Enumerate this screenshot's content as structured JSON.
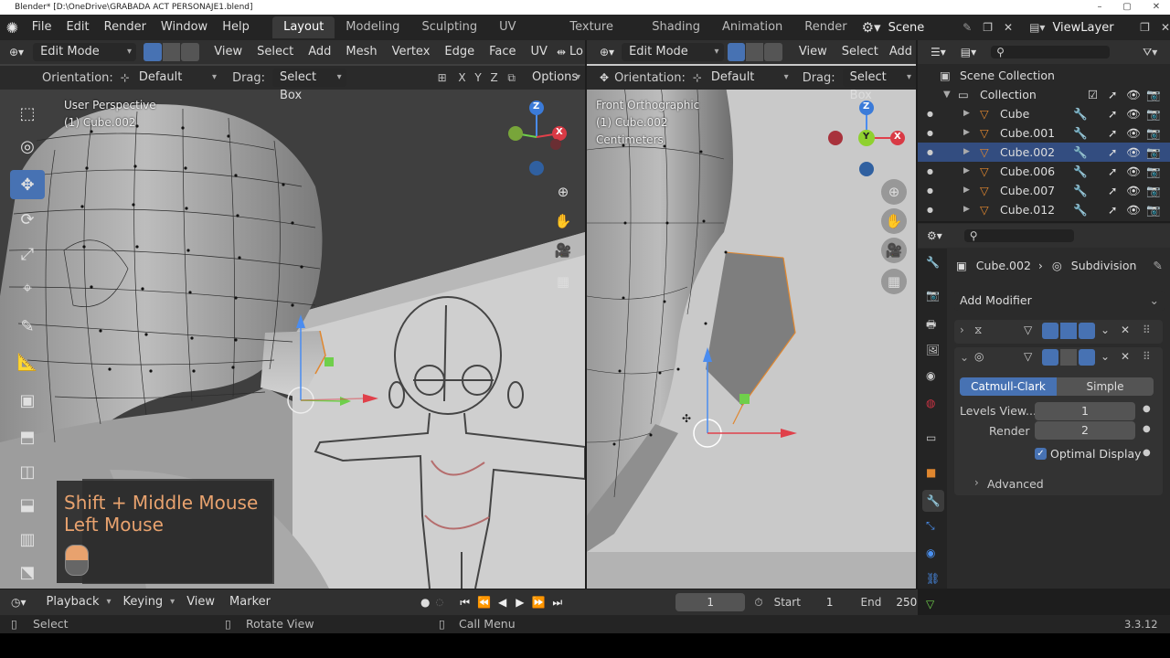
{
  "window": {
    "title": "Blender* [D:\\OneDrive\\GRABADA ACT PERSONAJE1.blend]",
    "minimize": "–",
    "maximize": "▢",
    "close": "✕"
  },
  "menubar": {
    "items": [
      "File",
      "Edit",
      "Render",
      "Window",
      "Help"
    ],
    "workspaces": [
      "Layout",
      "Modeling",
      "Sculpting",
      "UV Editing",
      "Texture Paint",
      "Shading",
      "Animation",
      "Render"
    ],
    "active_workspace": "Layout",
    "scene": "Scene",
    "view_layer": "ViewLayer"
  },
  "left_viewport": {
    "mode": "Edit Mode",
    "menus": [
      "View",
      "Select",
      "Add",
      "Mesh",
      "Vertex",
      "Edge",
      "Face",
      "UV",
      "Lo"
    ],
    "orientation_label": "Orientation:",
    "orientation_value": "Default",
    "drag_label": "Drag:",
    "drag_value": "Select Box",
    "axes": [
      "X",
      "Y",
      "Z"
    ],
    "options": "Options",
    "view_name": "User Perspective",
    "object_name": "(1) Cube.002",
    "keys_line1": "Shift + Middle Mouse",
    "keys_line2": "Left Mouse"
  },
  "right_viewport": {
    "mode": "Edit Mode",
    "menus": [
      "View",
      "Select",
      "Add"
    ],
    "orientation_label": "Orientation:",
    "orientation_value": "Default",
    "drag_label": "Drag:",
    "drag_value": "Select Box",
    "view_name": "Front Orthographic",
    "object_name": "(1) Cube.002",
    "units": "Centimeters"
  },
  "gizmo": {
    "left": {
      "z": "Z",
      "x": "X"
    },
    "right": {
      "z": "Z",
      "y": "Y",
      "x": "X"
    }
  },
  "outliner": {
    "root": "Scene Collection",
    "collection": "Collection",
    "items": [
      "Cube",
      "Cube.001",
      "Cube.002",
      "Cube.006",
      "Cube.007",
      "Cube.012"
    ],
    "selected": "Cube.002"
  },
  "properties": {
    "breadcrumb_object": "Cube.002",
    "breadcrumb_modifier": "Subdivision",
    "add_modifier": "Add Modifier",
    "subdivision": {
      "catmull": "Catmull-Clark",
      "simple": "Simple",
      "levels_label": "Levels View...",
      "levels_value": "1",
      "render_label": "Render",
      "render_value": "2",
      "optimal_display": "Optimal Display",
      "optimal_display_checked": true,
      "advanced": "Advanced"
    }
  },
  "timeline": {
    "menus": [
      "Playback",
      "Keying",
      "View",
      "Marker"
    ],
    "current_frame": "1",
    "start_label": "Start",
    "start_value": "1",
    "end_label": "End",
    "end_value": "250"
  },
  "statusbar": {
    "select": "Select",
    "rotate_view": "Rotate View",
    "call_menu": "Call Menu",
    "version": "3.3.12"
  },
  "colors": {
    "accent": "#4772b3",
    "selected_row": "#334d80",
    "header": "#303030",
    "panel": "#2b2b2b",
    "orange_edit": "#e0872f"
  }
}
